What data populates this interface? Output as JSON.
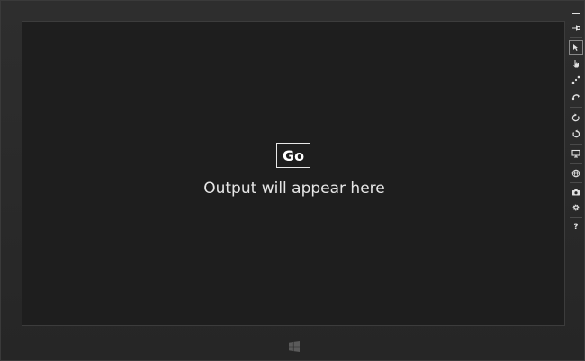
{
  "main": {
    "go_button_label": "Go",
    "output_text": "Output will appear here"
  },
  "toolbar": {
    "items": [
      {
        "icon": "minimize-icon"
      },
      {
        "icon": "pin-icon"
      },
      {
        "icon": "mouse-mode-icon",
        "selected": true
      },
      {
        "icon": "touch-mode-icon"
      },
      {
        "icon": "pinch-zoom-icon"
      },
      {
        "icon": "rotate-gesture-icon"
      },
      {
        "icon": "rotate-clockwise-icon"
      },
      {
        "icon": "rotate-counterclockwise-icon"
      },
      {
        "icon": "change-resolution-icon"
      },
      {
        "icon": "set-location-icon"
      },
      {
        "icon": "screenshot-icon"
      },
      {
        "icon": "settings-icon"
      },
      {
        "icon": "help-icon"
      }
    ],
    "help_glyph": "?"
  },
  "colors": {
    "background": "#1e1e1e",
    "frame": "#2a2a2a",
    "text": "#e6e6e6",
    "button_border": "#e8e8e8"
  }
}
